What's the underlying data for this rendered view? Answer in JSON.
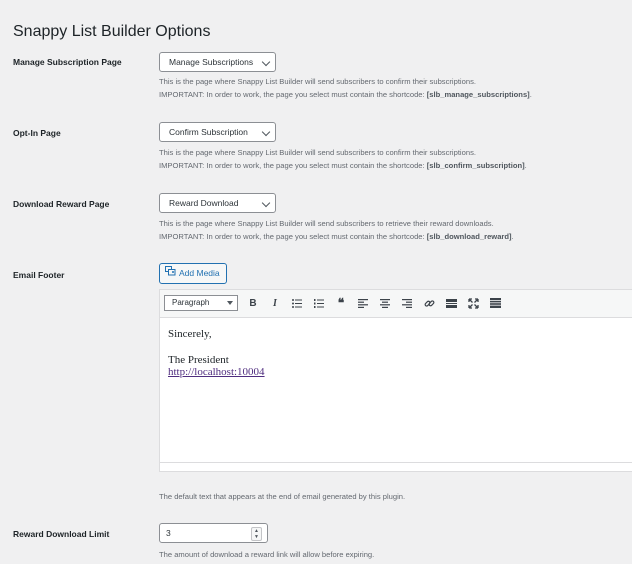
{
  "page": {
    "title": "Snappy List Builder Options"
  },
  "manage": {
    "label": "Manage Subscription Page",
    "selected": "Manage Subscriptions",
    "desc1": "This is the page where Snappy List Builder will send subscribers to confirm their subscriptions.",
    "desc2_prefix": "IMPORTANT: In order to work, the page you select must contain the shortcode: ",
    "shortcode": "[slb_manage_subscriptions]",
    "suffix": "."
  },
  "optin": {
    "label": "Opt-In Page",
    "selected": "Confirm Subscription",
    "desc1": "This is the page where Snappy List Builder will send subscribers to confirm their subscriptions.",
    "desc2_prefix": "IMPORTANT: In order to work, the page you select must contain the shortcode: ",
    "shortcode": "[slb_confirm_subscription]",
    "suffix": "."
  },
  "download": {
    "label": "Download Reward Page",
    "selected": "Reward Download",
    "desc1": "This is the page where Snappy List Builder will send subscribers to retrieve their reward downloads.",
    "desc2_prefix": "IMPORTANT: In order to work, the page you select must contain the shortcode: ",
    "shortcode": "[slb_download_reward]",
    "suffix": "."
  },
  "footer": {
    "label": "Email Footer",
    "add_media": "Add Media",
    "format": "Paragraph",
    "toolbar_icons": [
      "bold-icon",
      "italic-icon",
      "bullet-list-icon",
      "numbered-list-icon",
      "blockquote-icon",
      "align-left-icon",
      "align-center-icon",
      "align-right-icon",
      "link-icon",
      "read-more-icon",
      "fullscreen-icon",
      "toolbar-toggle-icon"
    ],
    "content": {
      "line1": "Sincerely,",
      "line2": "The President",
      "link": "http://localhost:10004"
    },
    "desc": "The default text that appears at the end of email generated by this plugin."
  },
  "limit": {
    "label": "Reward Download Limit",
    "value": "3",
    "desc": "The amount of download a reward link will allow before expiring."
  },
  "colors": {
    "accent": "#2271b1",
    "link_visited": "#4f2d7f"
  }
}
